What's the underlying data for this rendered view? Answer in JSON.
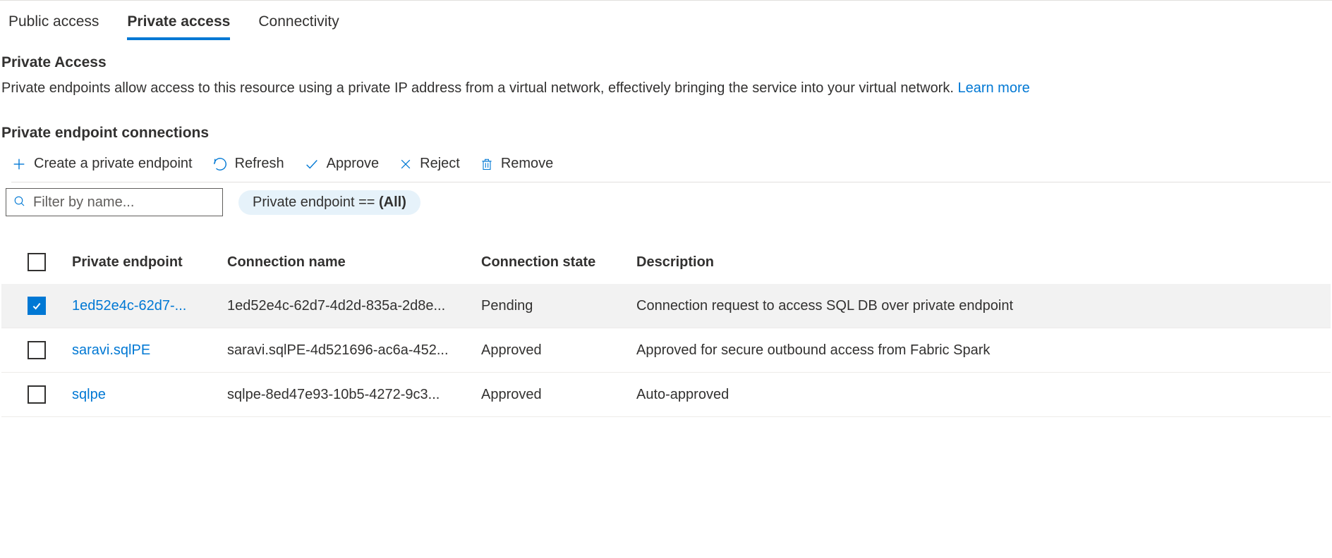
{
  "tabs": [
    {
      "label": "Public access",
      "active": false
    },
    {
      "label": "Private access",
      "active": true
    },
    {
      "label": "Connectivity",
      "active": false
    }
  ],
  "section": {
    "title": "Private Access",
    "description": "Private endpoints allow access to this resource using a private IP address from a virtual network, effectively bringing the service into your virtual network. ",
    "learn_more": "Learn more"
  },
  "subheading": "Private endpoint connections",
  "toolbar": {
    "create": "Create a private endpoint",
    "refresh": "Refresh",
    "approve": "Approve",
    "reject": "Reject",
    "remove": "Remove"
  },
  "filter": {
    "placeholder": "Filter by name...",
    "pill_prefix": "Private endpoint == ",
    "pill_value": "(All)"
  },
  "table": {
    "headers": {
      "endpoint": "Private endpoint",
      "connection": "Connection name",
      "state": "Connection state",
      "description": "Description"
    },
    "rows": [
      {
        "checked": true,
        "endpoint": "1ed52e4c-62d7-...",
        "connection": "1ed52e4c-62d7-4d2d-835a-2d8e...",
        "state": "Pending",
        "description": "Connection request to access SQL DB over private endpoint"
      },
      {
        "checked": false,
        "endpoint": "saravi.sqlPE",
        "connection": "saravi.sqlPE-4d521696-ac6a-452...",
        "state": "Approved",
        "description": "Approved for secure outbound access from Fabric Spark"
      },
      {
        "checked": false,
        "endpoint": "sqlpe",
        "connection": "sqlpe-8ed47e93-10b5-4272-9c3...",
        "state": "Approved",
        "description": "Auto-approved"
      }
    ]
  }
}
